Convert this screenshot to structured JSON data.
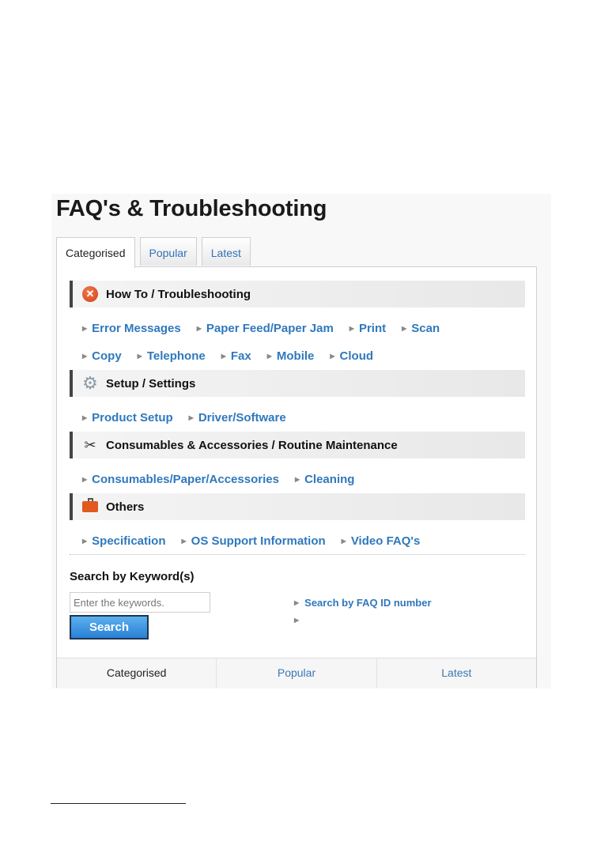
{
  "page": {
    "title": "FAQ's & Troubleshooting",
    "tabs": [
      {
        "label": "Categorised",
        "active": true
      },
      {
        "label": "Popular",
        "active": false
      },
      {
        "label": "Latest",
        "active": false
      }
    ],
    "categories": [
      {
        "title": "How To / Troubleshooting",
        "icon": "error-circle-icon",
        "rows": [
          [
            "Error Messages",
            "Paper Feed/Paper Jam",
            "Print",
            "Scan"
          ],
          [
            "Copy",
            "Telephone",
            "Fax",
            "Mobile",
            "Cloud"
          ]
        ]
      },
      {
        "title": "Setup / Settings",
        "icon": "gear-icon",
        "rows": [
          [
            "Product Setup",
            "Driver/Software"
          ]
        ]
      },
      {
        "title": "Consumables & Accessories / Routine Maintenance",
        "icon": "tools-icon",
        "rows": [
          [
            "Consumables/Paper/Accessories",
            "Cleaning"
          ]
        ]
      },
      {
        "title": "Others",
        "icon": "toolbox-icon",
        "rows": [
          [
            "Specification",
            "OS Support Information",
            "Video FAQ's"
          ]
        ]
      }
    ],
    "search": {
      "heading": "Search by Keyword(s)",
      "placeholder": "Enter the keywords.",
      "value": "",
      "button_label": "Search"
    },
    "side_links": [
      "Search by FAQ ID number",
      ""
    ],
    "bottom_tabs": [
      {
        "label": "Categorised",
        "active": true
      },
      {
        "label": "Popular",
        "active": false
      },
      {
        "label": "Latest",
        "active": false
      }
    ]
  }
}
